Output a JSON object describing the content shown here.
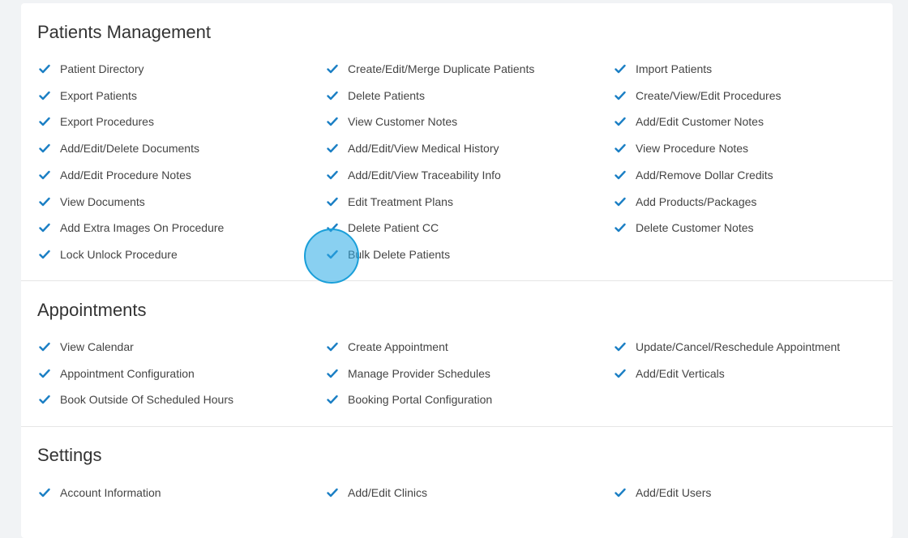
{
  "colors": {
    "checkbox": "#1b7fc4",
    "background": "#f1f3f5",
    "card": "#ffffff"
  },
  "sections": [
    {
      "title": "Patients Management",
      "items": [
        "Patient Directory",
        "Create/Edit/Merge Duplicate Patients",
        "Import Patients",
        "Export Patients",
        "Delete Patients",
        "Create/View/Edit Procedures",
        "Export Procedures",
        "View Customer Notes",
        "Add/Edit Customer Notes",
        "Add/Edit/Delete Documents",
        "Add/Edit/View Medical History",
        "View Procedure Notes",
        "Add/Edit Procedure Notes",
        "Add/Edit/View Traceability Info",
        "Add/Remove Dollar Credits",
        "View Documents",
        "Edit Treatment Plans",
        "Add Products/Packages",
        "Add Extra Images On Procedure",
        "Delete Patient CC",
        "Delete Customer Notes",
        "Lock Unlock Procedure",
        "Bulk Delete Patients"
      ]
    },
    {
      "title": "Appointments",
      "items": [
        "View Calendar",
        "Create Appointment",
        "Update/Cancel/Reschedule Appointment",
        "Appointment Configuration",
        "Manage Provider Schedules",
        "Add/Edit Verticals",
        "Book Outside Of Scheduled Hours",
        "Booking Portal Configuration"
      ]
    },
    {
      "title": "Settings",
      "items": [
        "Account Information",
        "Add/Edit Clinics",
        "Add/Edit Users"
      ]
    }
  ]
}
